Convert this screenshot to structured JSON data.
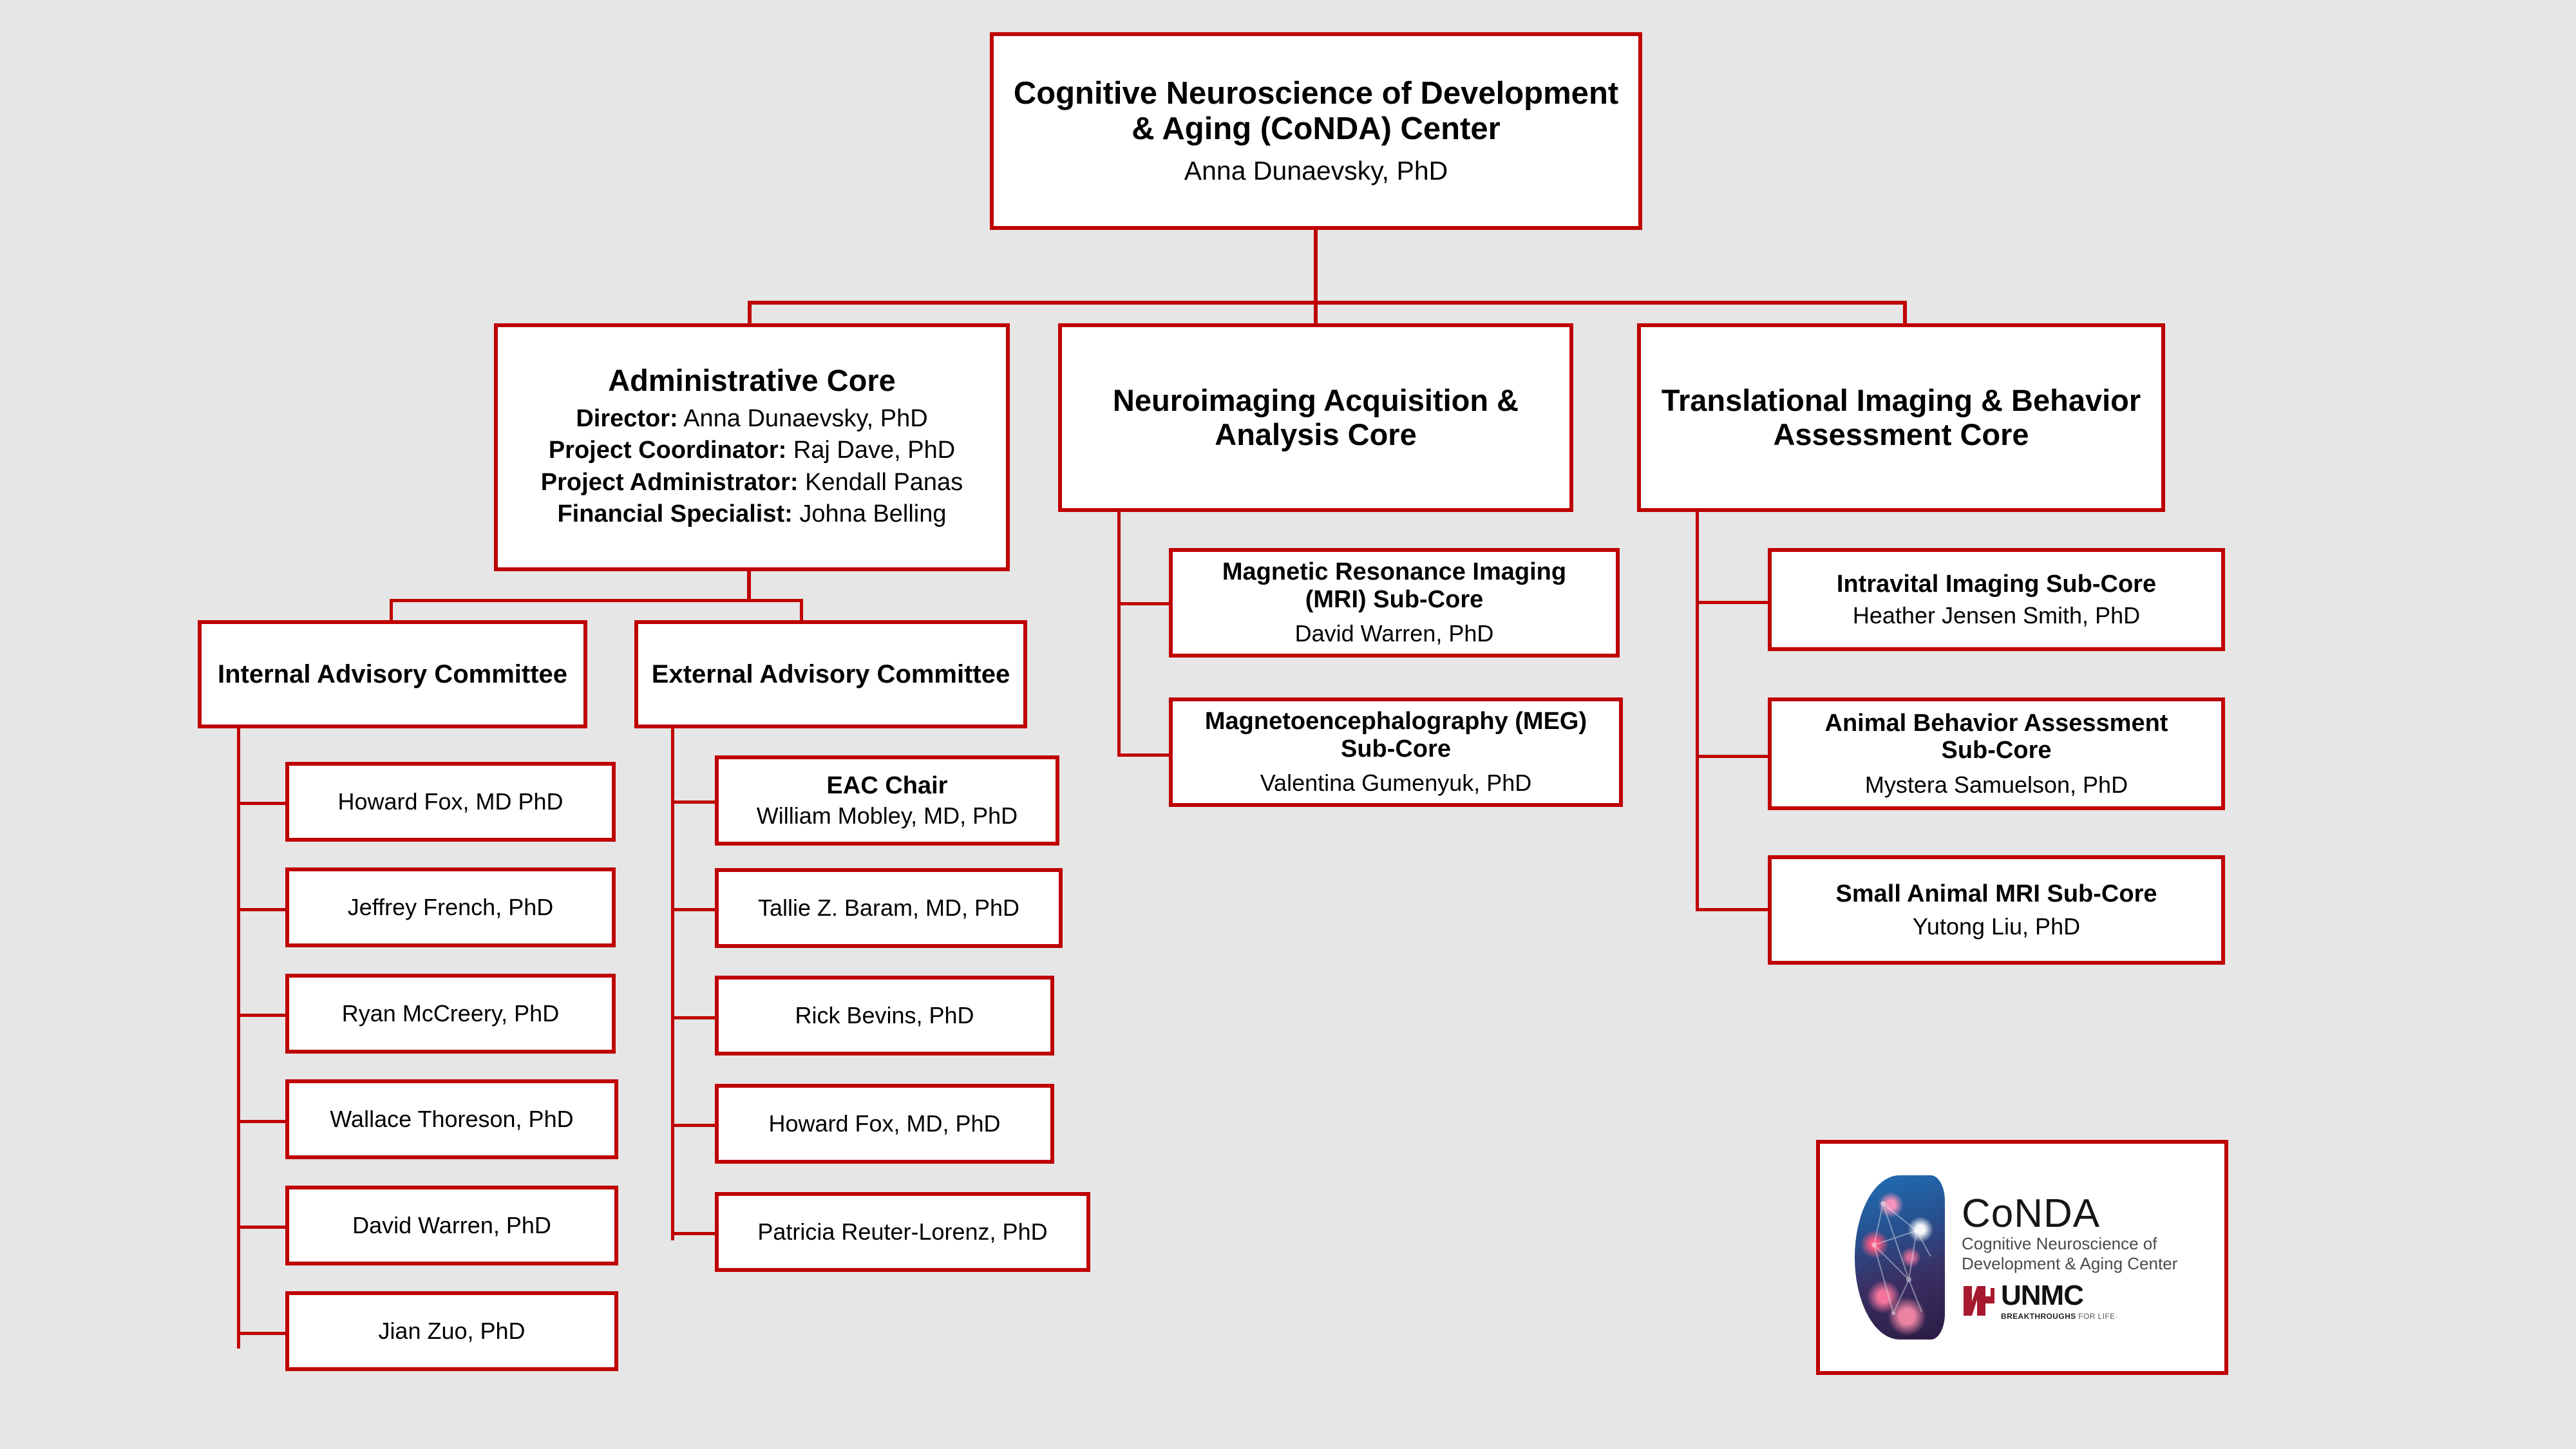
{
  "colors": {
    "background": "#e6e6e6",
    "box_border": "#bf0000",
    "box_fill": "#ffffff",
    "text": "#000000",
    "unmc_red": "#a6192e"
  },
  "root": {
    "title_line1": "Cognitive Neuroscience of Development",
    "title_line2": "& Aging (CoNDA) Center",
    "director": "Anna Dunaevsky, PhD"
  },
  "cores": {
    "administrative": {
      "title": "Administrative Core",
      "roles": [
        {
          "label": "Director:",
          "value": " Anna Dunaevsky, PhD"
        },
        {
          "label": "Project Coordinator:",
          "value": " Raj Dave, PhD"
        },
        {
          "label": "Project Administrator:",
          "value": " Kendall Panas"
        },
        {
          "label": "Financial Specialist:",
          "value": " Johna Belling"
        }
      ]
    },
    "neuroimaging": {
      "title_line1": "Neuroimaging Acquisition &",
      "title_line2": "Analysis Core",
      "subcores": [
        {
          "title_line1": "Magnetic Resonance Imaging",
          "title_line2": "(MRI) Sub-Core",
          "lead": "David Warren, PhD"
        },
        {
          "title_line1": "Magnetoencephalography (MEG)",
          "title_line2": "Sub-Core",
          "lead": "Valentina Gumenyuk, PhD"
        }
      ]
    },
    "translational": {
      "title_line1": "Translational Imaging & Behavior",
      "title_line2": "Assessment Core",
      "subcores": [
        {
          "title_line1": "Intravital Imaging Sub-Core",
          "title_line2": "",
          "lead": "Heather Jensen Smith, PhD"
        },
        {
          "title_line1": "Animal Behavior Assessment",
          "title_line2": "Sub-Core",
          "lead": "Mystera Samuelson, PhD"
        },
        {
          "title_line1": "Small Animal MRI Sub-Core",
          "title_line2": "",
          "lead": "Yutong Liu, PhD"
        }
      ]
    }
  },
  "committees": {
    "internal": {
      "title": "Internal Advisory Committee",
      "members": [
        "Howard Fox, MD PhD",
        "Jeffrey French, PhD",
        "Ryan McCreery, PhD",
        "Wallace Thoreson, PhD",
        "David Warren, PhD",
        "Jian Zuo, PhD"
      ]
    },
    "external": {
      "title": "External Advisory Committee",
      "chair": {
        "role": "EAC Chair",
        "name": "William Mobley, MD, PhD"
      },
      "members": [
        "Tallie Z. Baram, MD, PhD",
        "Rick Bevins, PhD",
        "Howard Fox, MD, PhD",
        "Patricia Reuter-Lorenz, PhD"
      ]
    }
  },
  "logo": {
    "acronym": "CoNDA",
    "line1": "Cognitive Neuroscience of",
    "line2": "Development & Aging Center",
    "university": "UNMC",
    "tagline_bold": "BREAKTHROUGHS",
    "tagline_light": " FOR LIFE·"
  }
}
